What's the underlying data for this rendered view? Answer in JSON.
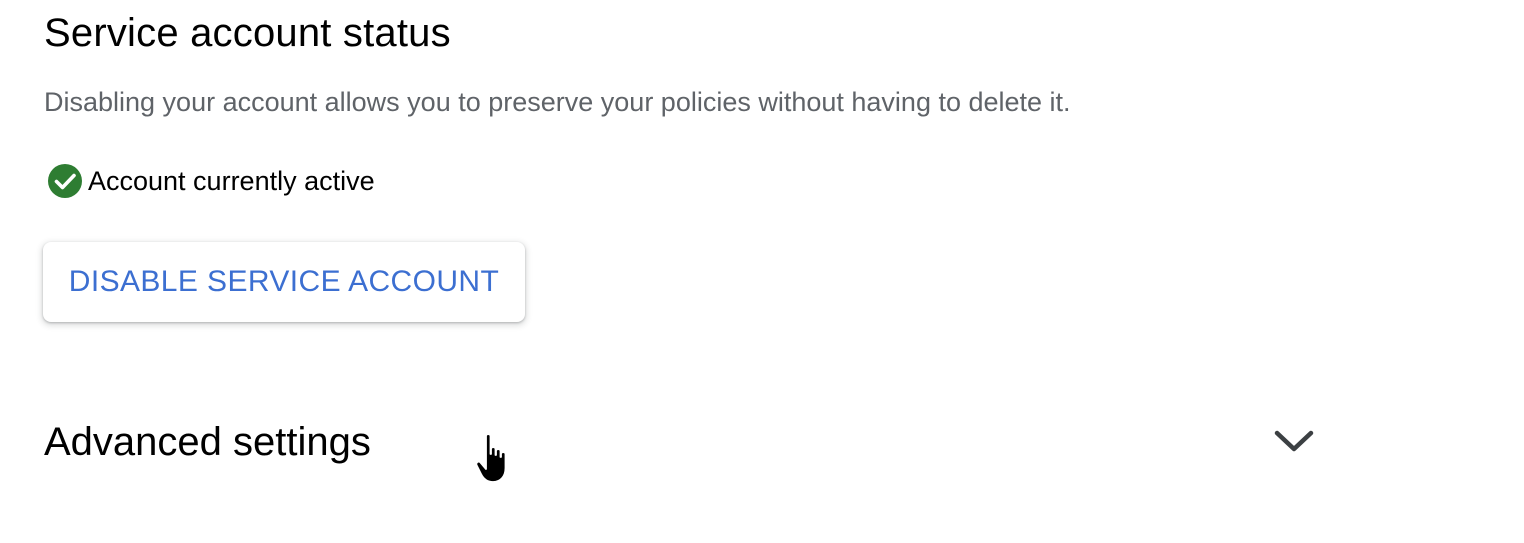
{
  "service_status": {
    "title": "Service account status",
    "description": "Disabling your account allows you to preserve your policies without having to delete it.",
    "status_icon": "check-circle-icon",
    "status_text": "Account currently active",
    "status_color": "#2e7d32",
    "disable_button_label": "DISABLE SERVICE ACCOUNT",
    "button_text_color": "#3c6fd1"
  },
  "advanced": {
    "title": "Advanced settings",
    "toggle_icon": "chevron-down-icon"
  },
  "cursor_icon": "hand-pointer-icon"
}
